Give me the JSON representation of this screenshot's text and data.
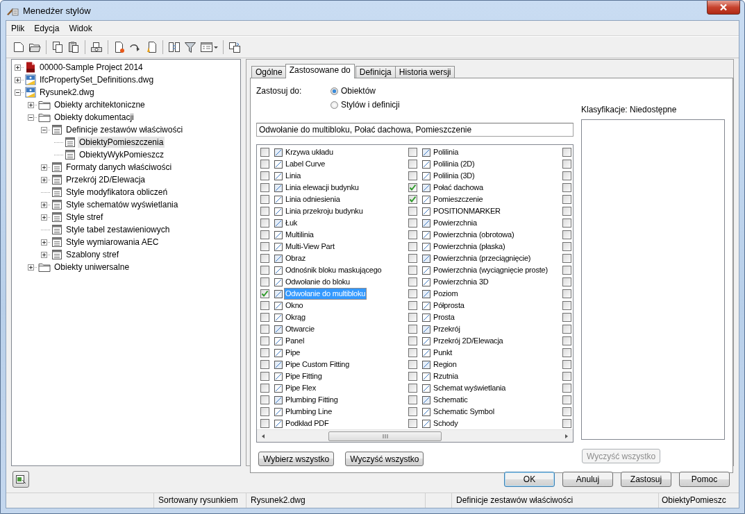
{
  "window": {
    "title": "Menedżer stylów"
  },
  "menu": [
    "Plik",
    "Edycja",
    "Widok"
  ],
  "tree": [
    {
      "label": "00000-Sample Project 2014",
      "expandable": true,
      "expanded": false,
      "selected": false
    },
    {
      "label": "IfcPropertySet_Definitions.dwg",
      "expandable": true,
      "expanded": false,
      "selected": false
    },
    {
      "label": "Rysunek2.dwg",
      "expandable": true,
      "expanded": true,
      "selected": false,
      "children": [
        {
          "label": "Obiekty architektoniczne",
          "expandable": true,
          "expanded": false,
          "selected": false
        },
        {
          "label": "Obiekty dokumentacji",
          "expandable": true,
          "expanded": true,
          "selected": false,
          "children": [
            {
              "label": "Definicje zestawów właściwości",
              "expandable": true,
              "expanded": true,
              "selected": false,
              "children": [
                {
                  "label": "ObiektyPomieszczenia",
                  "expandable": false,
                  "selected": true
                },
                {
                  "label": "ObiektyWykPomieszcz",
                  "expandable": false,
                  "selected": false
                }
              ]
            },
            {
              "label": "Formaty danych właściwości",
              "expandable": true,
              "expanded": false,
              "selected": false
            },
            {
              "label": "Przekrój 2D/Elewacja",
              "expandable": true,
              "expanded": false,
              "selected": false
            },
            {
              "label": "Style modyfikatora obliczeń",
              "expandable": false,
              "selected": false
            },
            {
              "label": "Style schematów wyświetlania",
              "expandable": true,
              "expanded": false,
              "selected": false
            },
            {
              "label": "Style stref",
              "expandable": true,
              "expanded": false,
              "selected": false
            },
            {
              "label": "Style tabel zestawieniowych",
              "expandable": false,
              "selected": false
            },
            {
              "label": "Style wymiarowania AEC",
              "expandable": true,
              "expanded": false,
              "selected": false
            },
            {
              "label": "Szablony stref",
              "expandable": true,
              "expanded": false,
              "selected": false
            }
          ]
        },
        {
          "label": "Obiekty uniwersalne",
          "expandable": true,
          "expanded": false,
          "selected": false
        }
      ]
    }
  ],
  "tabs": [
    {
      "label": "Ogólne",
      "selected": false
    },
    {
      "label": "Zastosowane do",
      "selected": true
    },
    {
      "label": "Definicja",
      "selected": false
    },
    {
      "label": "Historia wersji",
      "selected": false
    }
  ],
  "apply_to": {
    "label": "Zastosuj do:",
    "options": [
      {
        "label": "Obiektów",
        "selected": true
      },
      {
        "label": "Stylów i definicji",
        "selected": false
      }
    ]
  },
  "summary_field": {
    "value": "Odwołanie do multibloku, Połać dachowa, Pomieszczenie"
  },
  "object_list": {
    "columns": [
      [
        {
          "label": "Krzywa układu",
          "checked": false,
          "selected": false
        },
        {
          "label": "Label Curve",
          "checked": false,
          "selected": false
        },
        {
          "label": "Linia",
          "checked": false,
          "selected": false
        },
        {
          "label": "Linia elewacji budynku",
          "checked": false,
          "selected": false
        },
        {
          "label": "Linia odniesienia",
          "checked": false,
          "selected": false
        },
        {
          "label": "Linia przekroju budynku",
          "checked": false,
          "selected": false
        },
        {
          "label": "Łuk",
          "checked": false,
          "selected": false
        },
        {
          "label": "Multilinia",
          "checked": false,
          "selected": false
        },
        {
          "label": "Multi-View Part",
          "checked": false,
          "selected": false
        },
        {
          "label": "Obraz",
          "checked": false,
          "selected": false
        },
        {
          "label": "Odnośnik bloku maskującego",
          "checked": false,
          "selected": false
        },
        {
          "label": "Odwołanie do bloku",
          "checked": false,
          "selected": false
        },
        {
          "label": "Odwołanie do multibloku",
          "checked": true,
          "selected": true
        },
        {
          "label": "Okno",
          "checked": false,
          "selected": false
        },
        {
          "label": "Okrąg",
          "checked": false,
          "selected": false
        },
        {
          "label": "Otwarcie",
          "checked": false,
          "selected": false
        },
        {
          "label": "Panel",
          "checked": false,
          "selected": false
        },
        {
          "label": "Pipe",
          "checked": false,
          "selected": false
        },
        {
          "label": "Pipe Custom Fitting",
          "checked": false,
          "selected": false
        },
        {
          "label": "Pipe Fitting",
          "checked": false,
          "selected": false
        },
        {
          "label": "Pipe Flex",
          "checked": false,
          "selected": false
        },
        {
          "label": "Plumbing Fitting",
          "checked": false,
          "selected": false
        },
        {
          "label": "Plumbing Line",
          "checked": false,
          "selected": false
        },
        {
          "label": "Podkład PDF",
          "checked": false,
          "selected": false
        }
      ],
      [
        {
          "label": "Polilinia",
          "checked": false,
          "selected": false
        },
        {
          "label": "Polilinia (2D)",
          "checked": false,
          "selected": false
        },
        {
          "label": "Polilinia (3D)",
          "checked": false,
          "selected": false
        },
        {
          "label": "Połać dachowa",
          "checked": true,
          "selected": false
        },
        {
          "label": "Pomieszczenie",
          "checked": true,
          "selected": false
        },
        {
          "label": "POSITIONMARKER",
          "checked": false,
          "selected": false
        },
        {
          "label": "Powierzchnia",
          "checked": false,
          "selected": false
        },
        {
          "label": "Powierzchnia (obrotowa)",
          "checked": false,
          "selected": false
        },
        {
          "label": "Powierzchnia (płaska)",
          "checked": false,
          "selected": false
        },
        {
          "label": "Powierzchnia (przeciągnięcie)",
          "checked": false,
          "selected": false
        },
        {
          "label": "Powierzchnia (wyciągnięcie proste)",
          "checked": false,
          "selected": false
        },
        {
          "label": "Powierzchnia 3D",
          "checked": false,
          "selected": false
        },
        {
          "label": "Poziom",
          "checked": false,
          "selected": false
        },
        {
          "label": "Półprosta",
          "checked": false,
          "selected": false
        },
        {
          "label": "Prosta",
          "checked": false,
          "selected": false
        },
        {
          "label": "Przekrój",
          "checked": false,
          "selected": false
        },
        {
          "label": "Przekrój 2D/Elewacja",
          "checked": false,
          "selected": false
        },
        {
          "label": "Punkt",
          "checked": false,
          "selected": false
        },
        {
          "label": "Region",
          "checked": false,
          "selected": false
        },
        {
          "label": "Rzutnia",
          "checked": false,
          "selected": false
        },
        {
          "label": "Schemat wyświetlania",
          "checked": false,
          "selected": false
        },
        {
          "label": "Schematic",
          "checked": false,
          "selected": false
        },
        {
          "label": "Schematic Symbol",
          "checked": false,
          "selected": false
        },
        {
          "label": "Schody",
          "checked": false,
          "selected": false
        }
      ],
      [
        {
          "checked": false
        },
        {
          "checked": false
        },
        {
          "checked": false
        },
        {
          "checked": false
        },
        {
          "checked": false
        },
        {
          "checked": false
        },
        {
          "checked": false
        },
        {
          "checked": false
        },
        {
          "checked": false
        },
        {
          "checked": false
        },
        {
          "checked": false
        },
        {
          "checked": false
        },
        {
          "checked": false
        },
        {
          "checked": false
        },
        {
          "checked": false
        },
        {
          "checked": false
        },
        {
          "checked": false
        },
        {
          "checked": false
        },
        {
          "checked": false
        },
        {
          "checked": false
        },
        {
          "checked": false
        },
        {
          "checked": false
        },
        {
          "checked": false
        },
        {
          "checked": false
        }
      ]
    ]
  },
  "object_buttons": [
    "Wybierz wszystko",
    "Wyczyść wszystko"
  ],
  "classifications": {
    "label": "Klasyfikacje: Niedostępne",
    "clear_button": {
      "label": "Wyczyść wszystko",
      "disabled": true
    }
  },
  "dialog_buttons": [
    {
      "label": "OK",
      "default": true
    },
    {
      "label": "Anuluj",
      "default": false
    },
    {
      "label": "Zastosuj",
      "default": false
    },
    {
      "label": "Pomoc",
      "default": false
    }
  ],
  "status_bar": [
    "Sortowany rysunkiem",
    "Rysunek2.dwg",
    "Definicje zestawów właściwości",
    "ObiektyPomieszc"
  ]
}
